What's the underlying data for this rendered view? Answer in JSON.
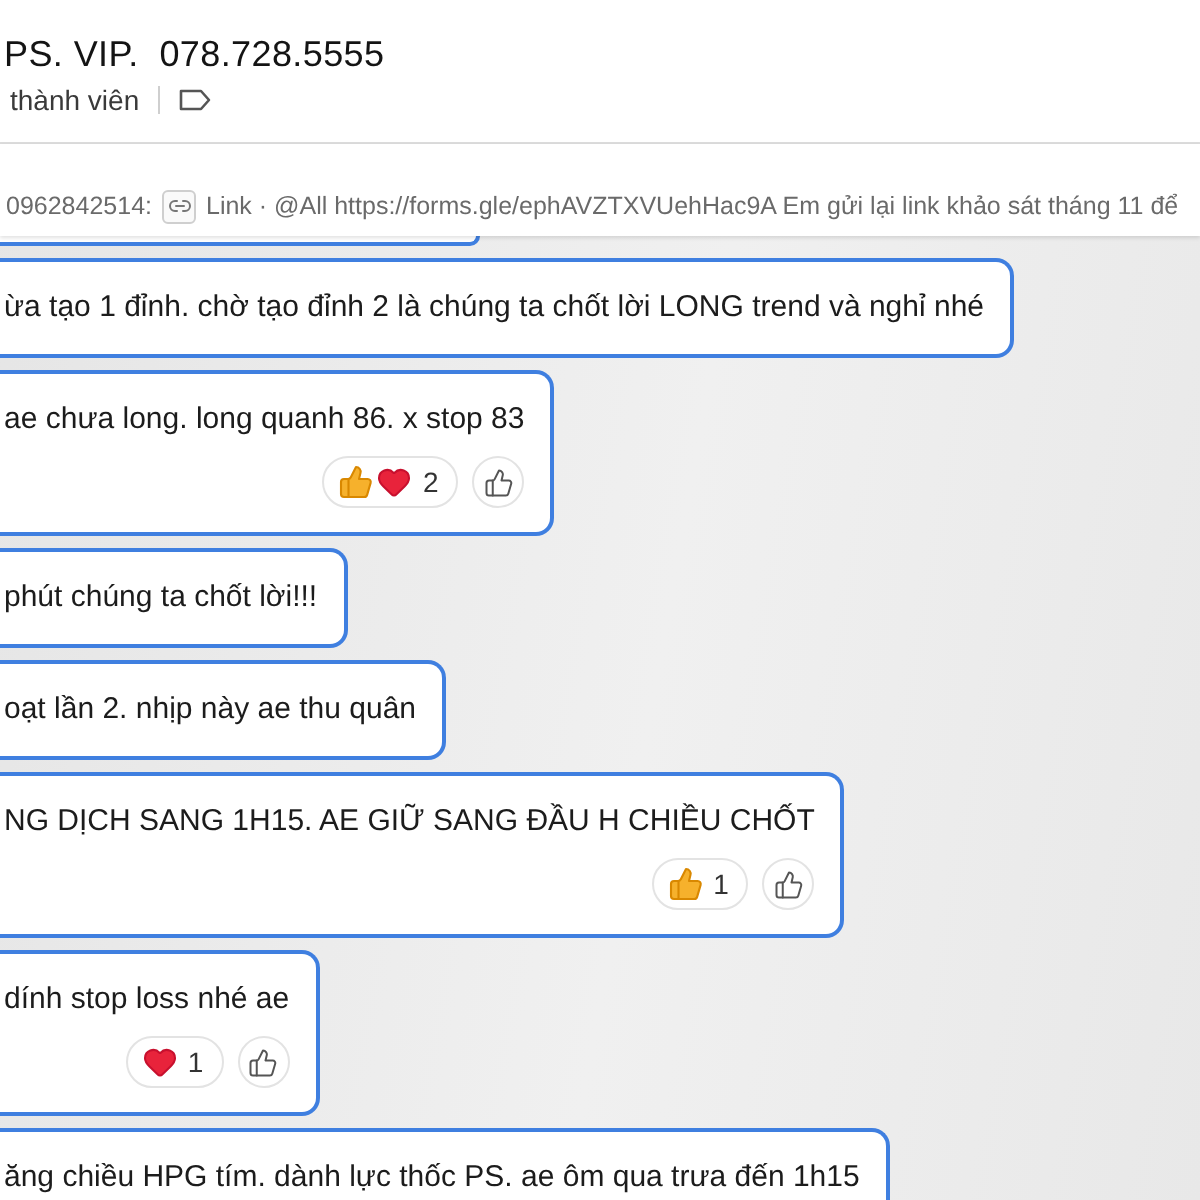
{
  "header": {
    "title": "PS. VIP.  078.728.5555",
    "subtitle": "thành viên"
  },
  "pinned": {
    "sender": "0962842514:",
    "text": "Link · @All https://forms.gle/ephAVZTXVUehHac9A Em gửi lại link khảo sát tháng 11 để"
  },
  "messages": [
    {
      "text": "ừa tạo 1 đỉnh. chờ tạo đỉnh 2 là chúng ta chốt lời LONG trend và nghỉ nhé"
    },
    {
      "text": "ae chưa long. long quanh 86. x stop 83",
      "reactions": {
        "emojis": [
          {
            "kind": "thumbs_up"
          },
          {
            "kind": "heart"
          }
        ],
        "count": "2"
      }
    },
    {
      "text": "phút chúng ta chốt lời!!!"
    },
    {
      "text": "oạt lần 2. nhịp này ae thu quân"
    },
    {
      "text": "NG DỊCH SANG 1H15. AE GIỮ SANG ĐẦU H CHIỀU CHỐT",
      "reactions": {
        "emojis": [
          {
            "kind": "thumbs_up"
          }
        ],
        "count": "1"
      }
    },
    {
      "text": "dính stop loss nhé ae",
      "reactions": {
        "emojis": [
          {
            "kind": "heart"
          }
        ],
        "count": "1"
      }
    },
    {
      "text": "ăng chiều HPG tím. dành lực thốc PS. ae ôm qua trưa đến 1h15"
    }
  ]
}
